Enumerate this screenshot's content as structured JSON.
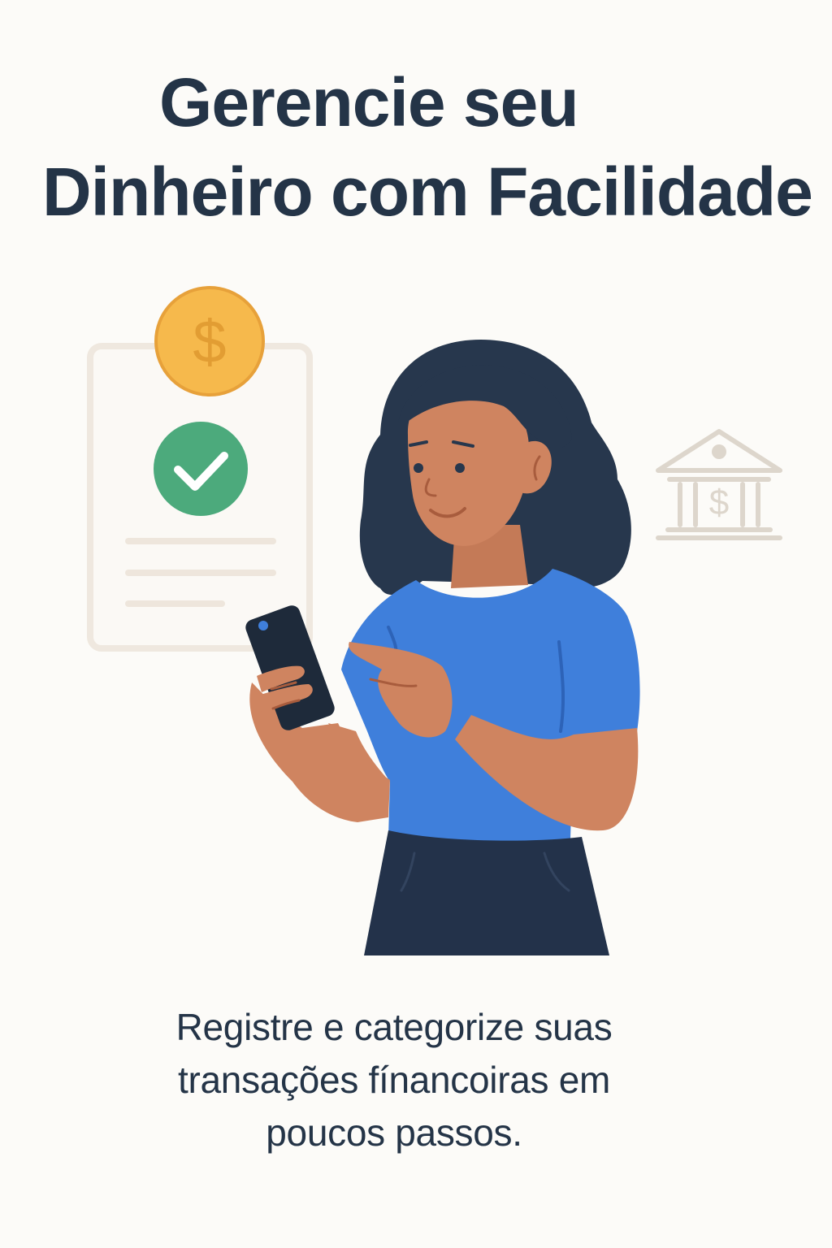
{
  "onboarding": {
    "headline": {
      "line1": "Gerencie seu",
      "line2": "Dinheiro com Facilidade"
    },
    "illustration": {
      "icons": [
        "document-icon",
        "coin-dollar-icon",
        "check-circle-icon",
        "bank-icon",
        "smartphone-icon"
      ],
      "coin_symbol": "$",
      "bank_symbol": "$"
    },
    "subtitle": {
      "line1": "Registre e categorize suas",
      "line2": "transações fínancoiras em",
      "line3": "poucos passos."
    }
  },
  "colors": {
    "background": "#fcfbf8",
    "text": "#243447",
    "coin": "#f6b94c",
    "check": "#4caa7c",
    "shirt": "#3f7fdb",
    "hair": "#27374d",
    "skin": "#cf8460",
    "pants": "#23324a",
    "phone": "#1e2a3a",
    "muted": "#ddd6cc"
  }
}
